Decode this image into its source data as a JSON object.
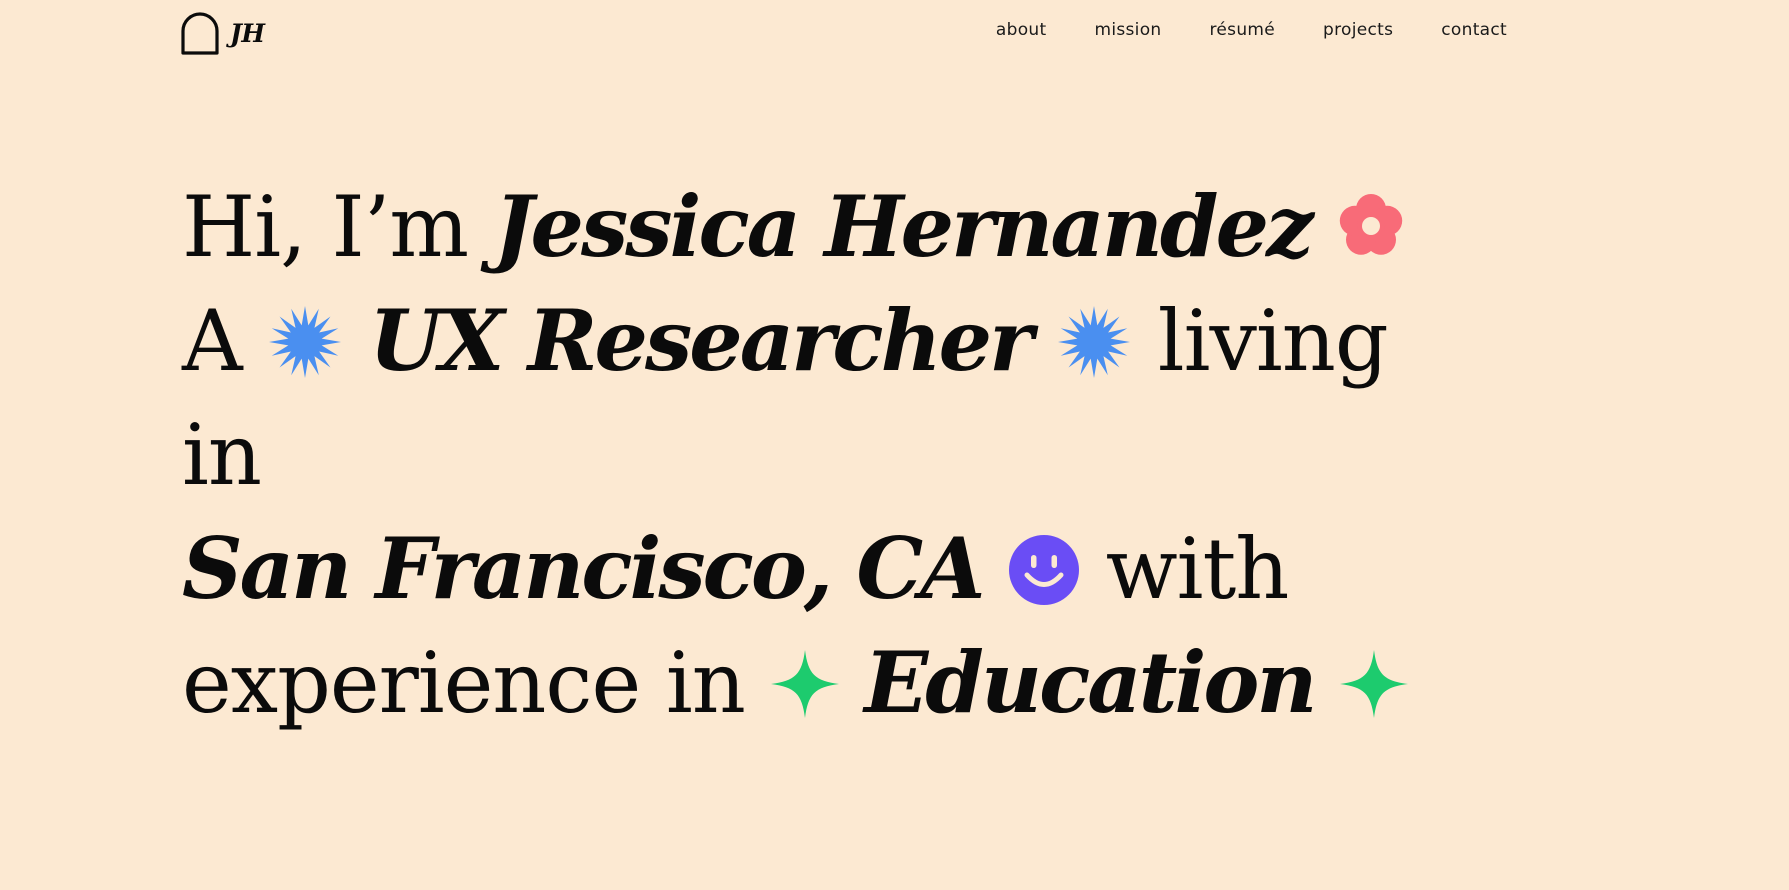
{
  "header": {
    "logo_text": "JH",
    "nav": [
      {
        "label": "about"
      },
      {
        "label": "mission"
      },
      {
        "label": "résumé"
      },
      {
        "label": "projects"
      },
      {
        "label": "contact"
      }
    ]
  },
  "hero": {
    "intro": "Hi, I’m",
    "name": "Jessica Hernandez",
    "article": "A",
    "role": "UX Researcher",
    "living": "living",
    "in": "in",
    "location": "San Francisco, CA",
    "with": "with",
    "experience_in": "experience in",
    "field": "Education"
  },
  "icons": {
    "flower": {
      "name": "flower-icon",
      "color": "#F86B78"
    },
    "starburst": {
      "name": "starburst-icon",
      "color": "#4A8FF0"
    },
    "smiley": {
      "name": "smiley-icon",
      "color": "#6A4DF5"
    },
    "sparkle": {
      "name": "sparkle-icon",
      "color": "#1DCB6E"
    }
  },
  "colors": {
    "background": "#FCE9D2",
    "text": "#0B0B0B"
  }
}
